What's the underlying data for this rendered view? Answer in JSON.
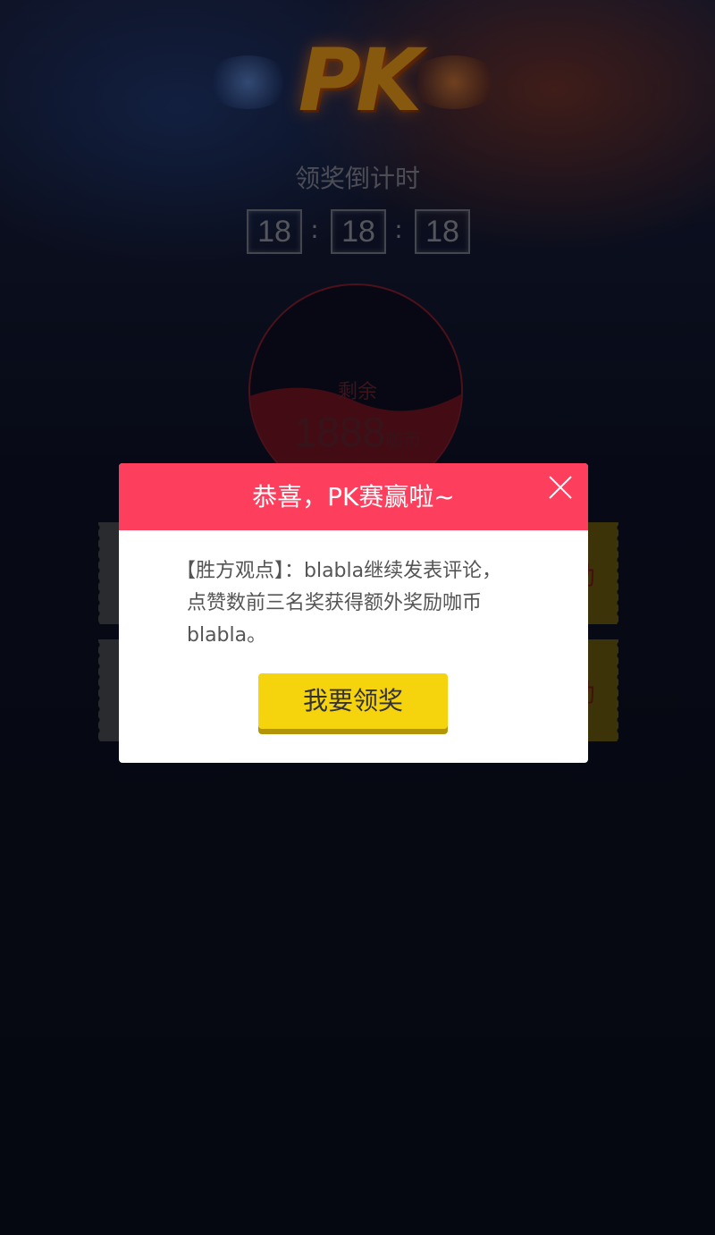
{
  "header": {
    "logo_text": "PK",
    "countdown_title": "领奖倒计时",
    "timer": {
      "hours": "18",
      "minutes": "18",
      "seconds": "18",
      "separator": ":"
    }
  },
  "pool": {
    "remaining_label": "剩余",
    "remaining_value": "1888",
    "remaining_unit": "咖币",
    "fill_fraction": 0.45
  },
  "tickets": [
    {
      "partial_label": "励"
    },
    {
      "partial_label": "励"
    }
  ],
  "dialog": {
    "title": "恭喜，PK赛赢啦~",
    "body_line1": "【胜方观点】：blabla继续发表评论，",
    "body_line2": "点赞数前三名奖获得额外奖励咖币",
    "body_line3": "blabla。",
    "claim_button": "我要领奖",
    "close_icon": "close-icon"
  },
  "colors": {
    "dialog_header": "#fd3e5c",
    "claim_button": "#f5d30d",
    "background": "#0b0f1f",
    "liquid": "#7a1727"
  }
}
